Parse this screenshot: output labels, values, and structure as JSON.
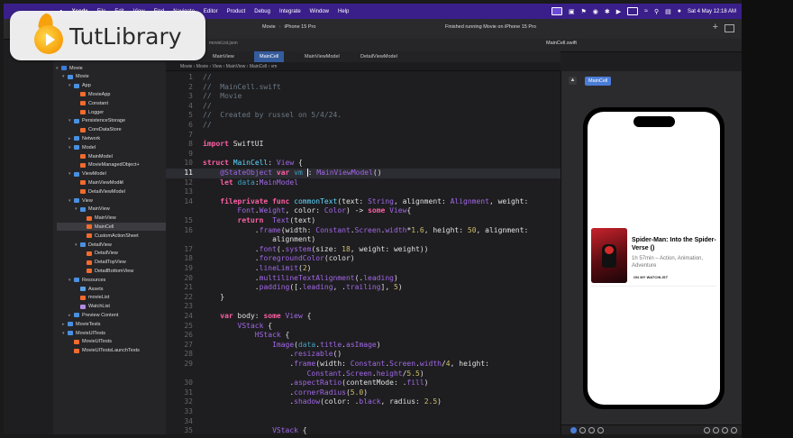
{
  "menubar": {
    "app": "Xcode",
    "items": [
      "File",
      "Edit",
      "View",
      "Find",
      "Navigate",
      "Editor",
      "Product",
      "Debug",
      "Integrate",
      "Window",
      "Help"
    ],
    "clock": "Sat 4 May  12:18 AM"
  },
  "toolbar": {
    "project": "Movie",
    "scheme": "Movie",
    "device": "iPhone 15 Pro",
    "status": "Finished running Movie on iPhone 15 Pro",
    "left_tab": "movieList.json",
    "right_tab": "MainCell.swift"
  },
  "editor_tabs": [
    "MainView",
    "MainCell",
    "MainViewModel",
    "DetailViewModel"
  ],
  "breadcrumb": [
    "Movie",
    "Movie",
    "View",
    "MainView",
    "MainCell",
    "vm"
  ],
  "navigator": [
    {
      "label": "Movie",
      "depth": 0,
      "icon": "proj",
      "chev": "down"
    },
    {
      "label": "Movie",
      "depth": 1,
      "icon": "folder",
      "chev": "down"
    },
    {
      "label": "App",
      "depth": 2,
      "icon": "folder",
      "chev": "down"
    },
    {
      "label": "MovieApp",
      "depth": 3,
      "icon": "swift",
      "chev": ""
    },
    {
      "label": "Constant",
      "depth": 3,
      "icon": "swift",
      "chev": ""
    },
    {
      "label": "Logger",
      "depth": 3,
      "icon": "swift",
      "chev": ""
    },
    {
      "label": "PersistenceStorage",
      "depth": 2,
      "icon": "folder",
      "chev": "down"
    },
    {
      "label": "CoreDataStore",
      "depth": 3,
      "icon": "swift",
      "chev": ""
    },
    {
      "label": "Network",
      "depth": 2,
      "icon": "folder",
      "chev": "right"
    },
    {
      "label": "Model",
      "depth": 2,
      "icon": "folder",
      "chev": "down"
    },
    {
      "label": "MainModel",
      "depth": 3,
      "icon": "swift",
      "chev": ""
    },
    {
      "label": "MovieManagedObject+",
      "depth": 3,
      "icon": "swift",
      "chev": ""
    },
    {
      "label": "ViewModel",
      "depth": 2,
      "icon": "folder",
      "chev": "down"
    },
    {
      "label": "MainViewModel",
      "depth": 3,
      "icon": "swift",
      "chev": "",
      "badge": "M"
    },
    {
      "label": "DetailViewModel",
      "depth": 3,
      "icon": "swift",
      "chev": ""
    },
    {
      "label": "View",
      "depth": 2,
      "icon": "folder",
      "chev": "down"
    },
    {
      "label": "MainView",
      "depth": 3,
      "icon": "folder",
      "chev": "down"
    },
    {
      "label": "MainView",
      "depth": 4,
      "icon": "swift",
      "chev": ""
    },
    {
      "label": "MainCell",
      "depth": 4,
      "icon": "swift",
      "chev": "",
      "badge": "M",
      "selected": true
    },
    {
      "label": "CustomActionSheet",
      "depth": 4,
      "icon": "swift",
      "chev": ""
    },
    {
      "label": "DetailView",
      "depth": 3,
      "icon": "folder",
      "chev": "down"
    },
    {
      "label": "DetailView",
      "depth": 4,
      "icon": "swift",
      "chev": ""
    },
    {
      "label": "DetailTopView",
      "depth": 4,
      "icon": "swift",
      "chev": ""
    },
    {
      "label": "DetailBottomView",
      "depth": 4,
      "icon": "swift",
      "chev": ""
    },
    {
      "label": "Resources",
      "depth": 2,
      "icon": "folder",
      "chev": "down"
    },
    {
      "label": "Assets",
      "depth": 3,
      "icon": "asset",
      "chev": ""
    },
    {
      "label": "movieList",
      "depth": 3,
      "icon": "swift",
      "chev": ""
    },
    {
      "label": "WatchList",
      "depth": 3,
      "icon": "data",
      "chev": ""
    },
    {
      "label": "Preview Content",
      "depth": 2,
      "icon": "folder",
      "chev": "right"
    },
    {
      "label": "MovieTests",
      "depth": 1,
      "icon": "folder",
      "chev": "right"
    },
    {
      "label": "MovieUITests",
      "depth": 1,
      "icon": "folder",
      "chev": "down"
    },
    {
      "label": "MovieUITests",
      "depth": 2,
      "icon": "swift",
      "chev": ""
    },
    {
      "label": "MovieUITestsLaunchTests",
      "depth": 2,
      "icon": "swift",
      "chev": ""
    }
  ],
  "code_lines": [
    {
      "no": "1",
      "html": "<span class=\"c\">//</span>"
    },
    {
      "no": "2",
      "html": "<span class=\"c\">//  MainCell.swift</span>"
    },
    {
      "no": "3",
      "html": "<span class=\"c\">//  Movie</span>"
    },
    {
      "no": "4",
      "html": "<span class=\"c\">//</span>"
    },
    {
      "no": "5",
      "html": "<span class=\"c\">//  Created by russel on 5/4/24.</span>"
    },
    {
      "no": "6",
      "html": "<span class=\"c\">//</span>"
    },
    {
      "no": "7",
      "html": ""
    },
    {
      "no": "8",
      "html": "<span class=\"k\">import</span> SwiftUI"
    },
    {
      "no": "9",
      "html": ""
    },
    {
      "no": "10",
      "html": "<span class=\"k\">struct</span> <span class=\"t\">MainCell</span>: <span class=\"p\">View</span> {"
    },
    {
      "no": "11",
      "html": "    <span class=\"p\">@StateObject</span> <span class=\"k\">var</span> <span class=\"m\">vm</span> <span class=\"caret\"></span>: <span class=\"p\">MainViewModel</span>()",
      "hl": true
    },
    {
      "no": "12",
      "html": "    <span class=\"k\">let</span> <span class=\"m\">data</span>:<span class=\"p\">MainModel</span>"
    },
    {
      "no": "13",
      "html": ""
    },
    {
      "no": "14",
      "html": "    <span class=\"k\">fileprivate</span> <span class=\"k\">func</span> <span class=\"t\">commonText</span>(text: <span class=\"p\">String</span>, alignment: <span class=\"p\">Alignment</span>, weight:"
    },
    {
      "no": "",
      "html": "        <span class=\"p\">Font</span>.<span class=\"p\">Weight</span>, color: <span class=\"p\">Color</span>) -> <span class=\"k\">some</span> <span class=\"p\">View</span>{"
    },
    {
      "no": "15",
      "html": "        <span class=\"k\">return</span>  <span class=\"p\">Text</span>(text)"
    },
    {
      "no": "16",
      "html": "            .<span class=\"p\">frame</span>(width: <span class=\"p\">Constant</span>.<span class=\"p\">Screen</span>.<span class=\"p\">width</span>*<span class=\"n\">1.6</span>, height: <span class=\"n\">50</span>, alignment:"
    },
    {
      "no": "",
      "html": "                alignment)"
    },
    {
      "no": "17",
      "html": "            .<span class=\"p\">font</span>(.<span class=\"p\">system</span>(size: <span class=\"n\">18</span>, weight: weight))"
    },
    {
      "no": "18",
      "html": "            .<span class=\"p\">foregroundColor</span>(color)"
    },
    {
      "no": "19",
      "html": "            .<span class=\"p\">lineLimit</span>(<span class=\"n\">2</span>)"
    },
    {
      "no": "20",
      "html": "            .<span class=\"p\">multilineTextAlignment</span>(.<span class=\"p\">leading</span>)"
    },
    {
      "no": "21",
      "html": "            .<span class=\"p\">padding</span>([.<span class=\"p\">leading</span>, .<span class=\"p\">trailing</span>], <span class=\"n\">5</span>)"
    },
    {
      "no": "22",
      "html": "    }"
    },
    {
      "no": "23",
      "html": ""
    },
    {
      "no": "24",
      "html": "    <span class=\"k\">var</span> body: <span class=\"k\">some</span> <span class=\"p\">View</span> {"
    },
    {
      "no": "25",
      "html": "        <span class=\"p\">VStack</span> {"
    },
    {
      "no": "26",
      "html": "            <span class=\"p\">HStack</span> {"
    },
    {
      "no": "27",
      "html": "                <span class=\"p\">Image</span>(<span class=\"m\">data</span>.<span class=\"p\">title</span>.<span class=\"p\">asImage</span>)"
    },
    {
      "no": "28",
      "html": "                    .<span class=\"p\">resizable</span>()"
    },
    {
      "no": "29",
      "html": "                    .<span class=\"p\">frame</span>(width: <span class=\"p\">Constant</span>.<span class=\"p\">Screen</span>.<span class=\"p\">width</span>/<span class=\"n\">4</span>, height:"
    },
    {
      "no": "",
      "html": "                        <span class=\"p\">Constant</span>.<span class=\"p\">Screen</span>.<span class=\"p\">height</span>/<span class=\"n\">5.5</span>)"
    },
    {
      "no": "30",
      "html": "                    .<span class=\"p\">aspectRatio</span>(contentMode: .<span class=\"p\">fill</span>)"
    },
    {
      "no": "31",
      "html": "                    .<span class=\"p\">cornerRadius</span>(<span class=\"n\">5.0</span>)"
    },
    {
      "no": "32",
      "html": "                    .<span class=\"p\">shadow</span>(color: .<span class=\"p\">black</span>, radius: <span class=\"n\">2.5</span>)"
    },
    {
      "no": "33",
      "html": ""
    },
    {
      "no": "34",
      "html": ""
    },
    {
      "no": "35",
      "html": "                <span class=\"p\">VStack</span> {"
    }
  ],
  "preview": {
    "chip": "MainCell",
    "title": "Spider-Man: Into the Spider-Verse ()",
    "meta": "1h 57min – Action, Animation, Adventure",
    "watch_label": "ON MY WATCHLIST"
  },
  "logo": {
    "text": "TutLibrary"
  }
}
